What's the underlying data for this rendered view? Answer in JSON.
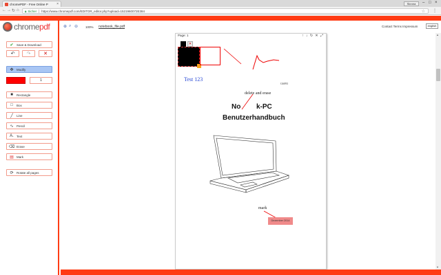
{
  "browser": {
    "tab_title": "chromePDF - Free Online P",
    "tab_close": "×",
    "user_label": "Skrona",
    "minimize": "–",
    "maximize": "□",
    "close": "×",
    "secure_label": "Sicher",
    "url": "https://www.chromepdf.com/EDITOR_editor.php?upload=1521960072E384",
    "back": "←",
    "forward": "→",
    "reload": "↻",
    "home": "⌂",
    "bookmark_star": "☆",
    "menu": "⋮"
  },
  "logo": {
    "part1": "chrome",
    "part2": "pdf"
  },
  "sidebar": {
    "save_label": "Save & Download",
    "undo": "↶",
    "redo": "↷",
    "delete": "✕",
    "modify_label": "Modify",
    "color": "#ff0000",
    "stroke_width": "1",
    "tools": [
      {
        "label": "Rectangle",
        "icon": "■"
      },
      {
        "label": "Box",
        "icon": "□"
      },
      {
        "label": "Line",
        "icon": "╱"
      },
      {
        "label": "Pencil",
        "icon": "∿"
      },
      {
        "label": "Text",
        "icon": "A."
      },
      {
        "label": "Erase",
        "icon": "⌫"
      },
      {
        "label": "Mark",
        "icon": "▤"
      }
    ],
    "rotate_label": "Rotate all pages"
  },
  "toolbar": {
    "zoom_in": "⊕",
    "zoom_search": "⌕",
    "zoom_out": "⊖",
    "zoom": "100%",
    "filename": "notebook_file.pdf",
    "contact": "Contact  Terms  Impressum",
    "language": "english"
  },
  "page": {
    "label": "Page: 1",
    "controls": "↑ ↓ ↻ ✕ ⤢",
    "test_text": "Test 123",
    "small_text": "G6093",
    "delete_text": "delete and erase",
    "title_no": "No",
    "title_kpc": "k-PC",
    "title_handbuch": "Benutzerhandbuch",
    "mark_text": "mark",
    "date_text": "Dezember 2014"
  },
  "colors": {
    "accent": "#ff3b14",
    "modify": "#a9c6f4",
    "annotation_red": "#e00000",
    "mark_pink": "#f08a8a"
  }
}
